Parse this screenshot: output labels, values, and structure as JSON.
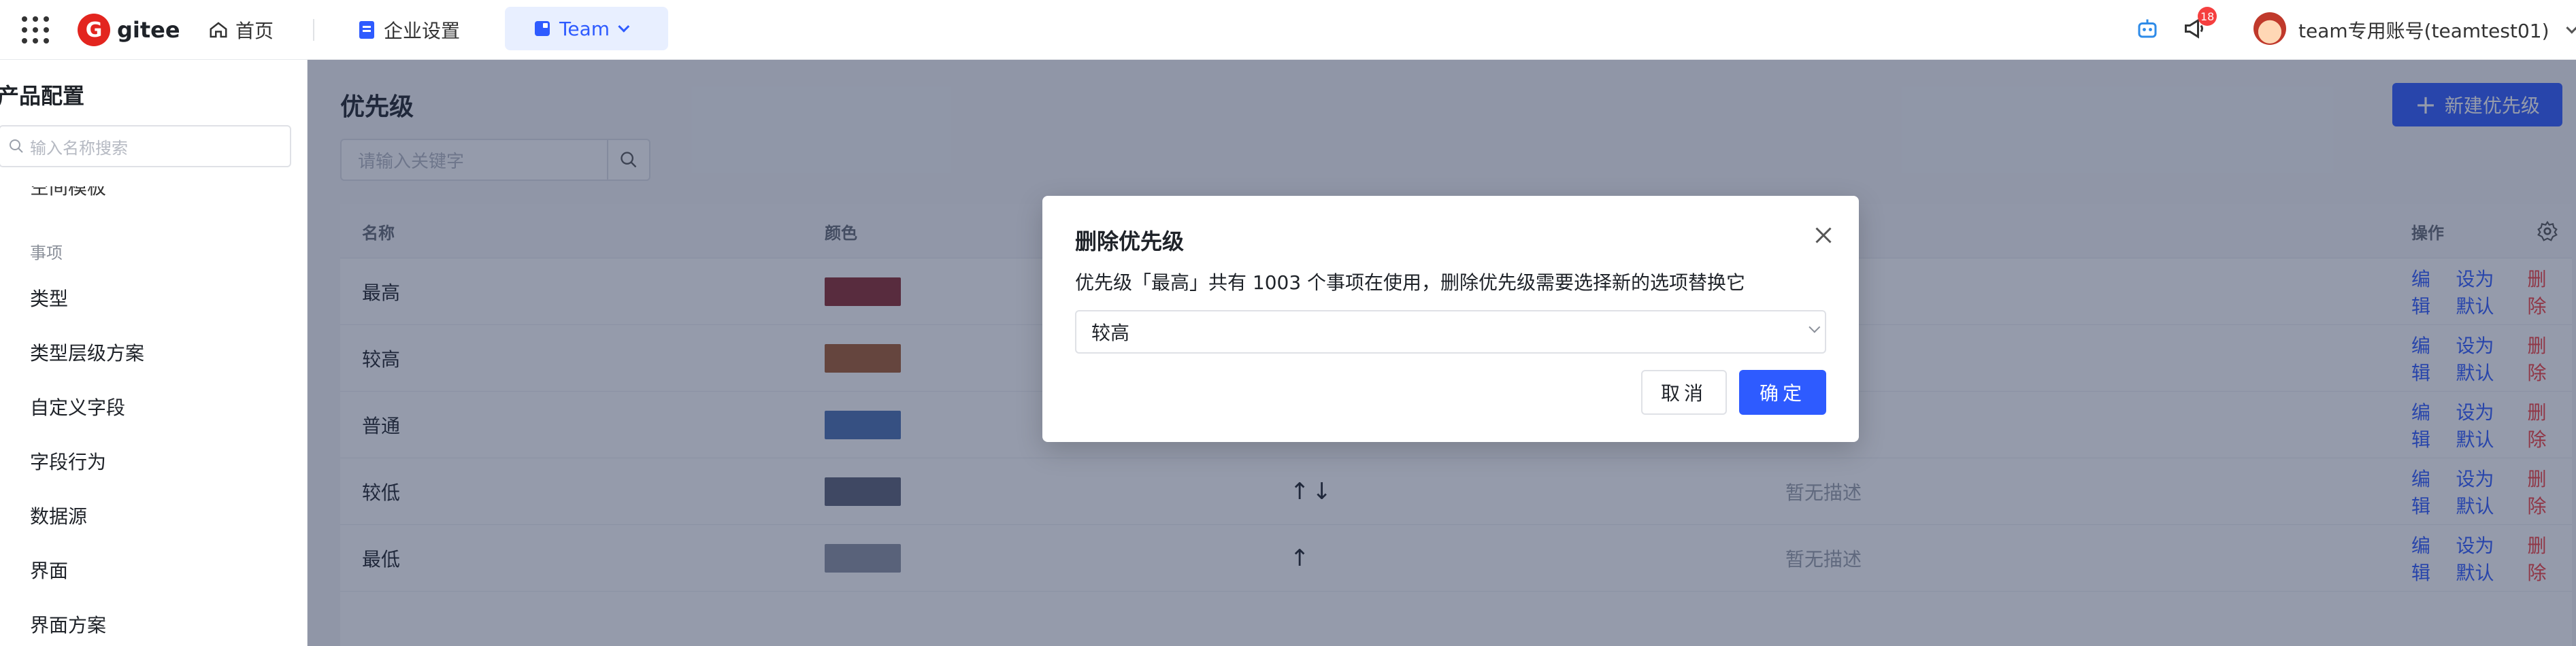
{
  "topbar": {
    "brand": "gitee",
    "nav_home": "首页",
    "nav_enterprise": "企业设置",
    "nav_team": "Team",
    "notification_count": "18",
    "user_name": "team专用账号(teamtest01)"
  },
  "sidebar": {
    "title": "产品配置",
    "search_placeholder": "输入名称搜索",
    "cut_item": "空间模板",
    "group_label": "事项",
    "items": [
      "类型",
      "类型层级方案",
      "自定义字段",
      "字段行为",
      "数据源",
      "界面",
      "界面方案"
    ]
  },
  "main": {
    "title": "优先级",
    "new_button": "新建优先级",
    "keyword_placeholder": "请输入关键字",
    "columns": {
      "name": "名称",
      "color": "颜色",
      "action": "操作"
    },
    "rows": [
      {
        "name": "最高",
        "color": "#8b2b2f",
        "sort": "",
        "desc": ""
      },
      {
        "name": "较高",
        "color": "#a35a2f",
        "sort": "",
        "desc": ""
      },
      {
        "name": "普通",
        "color": "#4a6fb0",
        "sort": "",
        "desc": ""
      },
      {
        "name": "较低",
        "color": "#5b6176",
        "sort": "↑↓",
        "desc": "暂无描述"
      },
      {
        "name": "最低",
        "color": "#8d92a1",
        "sort": "↑",
        "desc": "暂无描述"
      }
    ],
    "actions": {
      "edit": "编辑",
      "set_default": "设为默认",
      "delete": "删除"
    }
  },
  "modal": {
    "title": "删除优先级",
    "description": "优先级「最高」共有 1003 个事项在使用，删除优先级需要选择新的选项替换它",
    "select_value": "较高",
    "cancel": "取消",
    "ok": "确定"
  },
  "colors": {
    "accent": "#2e5bff",
    "danger": "#f53f3f",
    "overlay": "rgba(33,47,80,0.48)"
  }
}
